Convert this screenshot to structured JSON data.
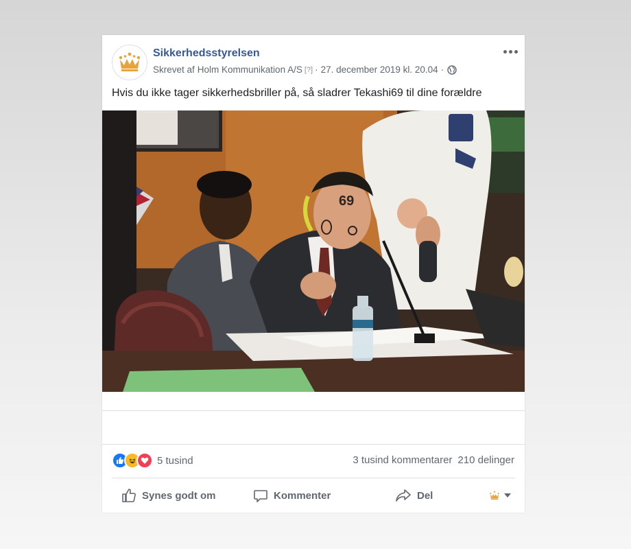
{
  "post": {
    "page_name": "Sikkerhedsstyrelsen",
    "written_by": "Skrevet af",
    "agency": "Holm Kommunikation A/S",
    "info_mark": "[?]",
    "separator": "·",
    "timestamp": "27. december 2019 kl. 20.04",
    "text": "Hvis du ikke tager sikkerhedsbriller på, så sladrer Tekashi69 til dine forældre"
  },
  "engagement": {
    "reaction_count": "5 tusind",
    "comments": "3 tusind kommentarer",
    "shares": "210 delinger"
  },
  "actions": {
    "like": "Synes godt om",
    "comment": "Kommenter",
    "share": "Del"
  },
  "colors": {
    "brand_blue": "#365899",
    "like_blue": "#1877f2",
    "haha_yellow": "#f7b928",
    "love_red": "#f33e58",
    "crown_gold": "#e8a33a"
  },
  "icons": [
    "crown-logo-icon",
    "globe-icon",
    "more-icon",
    "like-reaction-icon",
    "haha-reaction-icon",
    "love-reaction-icon",
    "thumbs-up-icon",
    "comment-bubble-icon",
    "share-arrow-icon",
    "chevron-down-icon"
  ]
}
